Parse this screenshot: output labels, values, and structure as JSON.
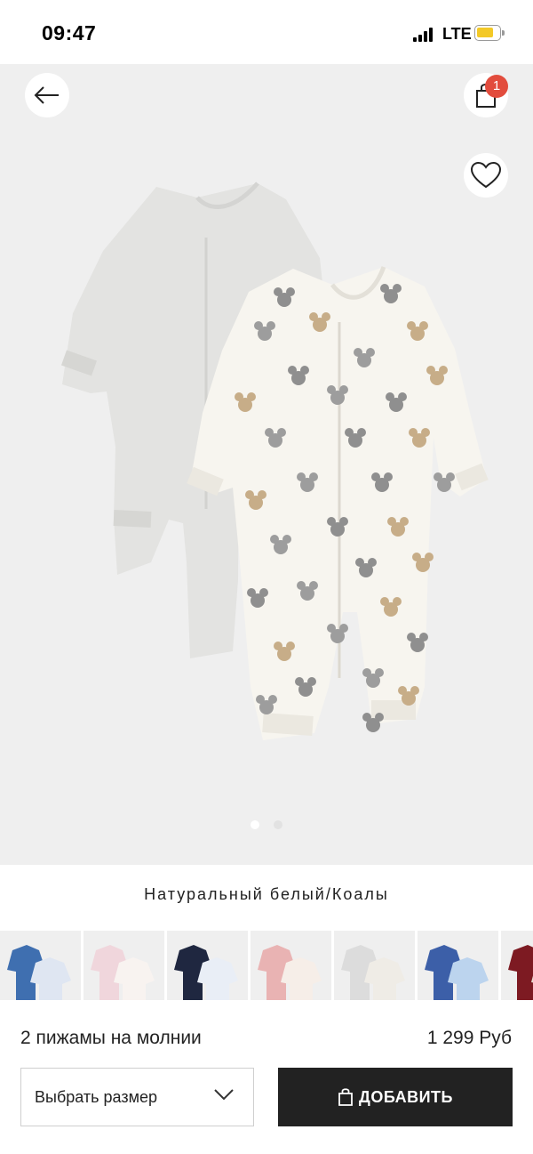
{
  "status": {
    "time": "09:47",
    "network": "LTE"
  },
  "header": {
    "cart_count": "1"
  },
  "gallery": {
    "image_count": 2,
    "active_index": 0
  },
  "product": {
    "color_name": "Натуральный белый/Коалы",
    "name": "2 пижамы на молнии",
    "price": "1 299 Руб"
  },
  "swatches": [
    {
      "name": "blue-stripes",
      "colors": [
        "#3f6fb0",
        "#dfe6f2"
      ]
    },
    {
      "name": "pink-print",
      "colors": [
        "#f0d6dc",
        "#f8f3f0"
      ]
    },
    {
      "name": "navy-stripes",
      "colors": [
        "#1f2740",
        "#e9eef6"
      ]
    },
    {
      "name": "pink-bunny",
      "colors": [
        "#e9b3b3",
        "#f6eee8"
      ]
    },
    {
      "name": "grey-koala",
      "colors": [
        "#dcdcdc",
        "#efece6"
      ]
    },
    {
      "name": "blue-elephant",
      "colors": [
        "#3c5fa8",
        "#bcd4ee"
      ]
    },
    {
      "name": "burgundy",
      "colors": [
        "#7d1a22",
        "#e8dcd0"
      ]
    }
  ],
  "actions": {
    "size_placeholder": "Выбрать размер",
    "add_label": "ДОБАВИТЬ"
  },
  "colors": {
    "accent": "#e24c3d",
    "button_dark": "#222222",
    "gallery_bg": "#efefef"
  }
}
